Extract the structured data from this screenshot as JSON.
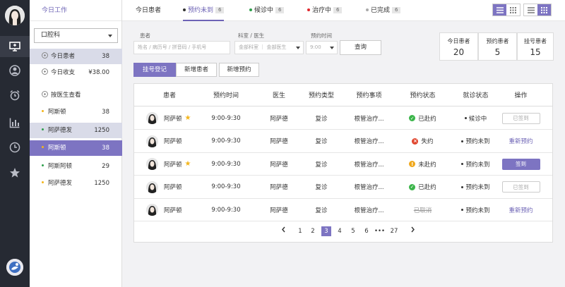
{
  "sidebar": {
    "header": "今日工作",
    "department": "口腔科",
    "rows": [
      {
        "label": "今日患者",
        "value": "38"
      },
      {
        "label": "今日收支",
        "value": "¥38.00"
      },
      {
        "label": "按医生查看",
        "value": ""
      },
      {
        "label": "阿斯顿",
        "value": "38",
        "dot": "#f3b51b"
      },
      {
        "label": "阿萨德发",
        "value": "1250",
        "dot": "#2e9f4b"
      },
      {
        "label": "阿斯顿",
        "value": "38",
        "dot": "#f3b51b"
      },
      {
        "label": "阿斯阿顿",
        "value": "29",
        "dot": "#2e9f4b"
      },
      {
        "label": "阿萨德发",
        "value": "1250",
        "dot": "#f3b51b"
      }
    ]
  },
  "tabs": [
    {
      "label": "今日患者",
      "count": ""
    },
    {
      "label": "预约未到",
      "count": "6",
      "dot": "#333333"
    },
    {
      "label": "候诊中",
      "count": "6",
      "dot": "#2e9f4b"
    },
    {
      "label": "治疗中",
      "count": "6",
      "dot": "#e0282e"
    },
    {
      "label": "已完成",
      "count": "6",
      "dot": "#aaaaaa"
    }
  ],
  "filters": {
    "patient_label": "患者",
    "patient_placeholder": "姓名 / 病历号 / 拼音码 / 手机号",
    "dept_label": "科室 / 医生",
    "dept_value": "金部科室 ｜ 金部医生",
    "time_label": "预约时间",
    "time_value": "9:00",
    "query": "查询"
  },
  "stats": [
    {
      "label": "今日患者",
      "value": "20"
    },
    {
      "label": "预约患者",
      "value": "5"
    },
    {
      "label": "挂号患者",
      "value": "15"
    }
  ],
  "actions": [
    "挂号登记",
    "新增患者",
    "新增预约"
  ],
  "table": {
    "headers": [
      "患者",
      "预约时间",
      "医生",
      "预约类型",
      "预约事项",
      "预约状态",
      "就诊状态",
      "操作"
    ],
    "rows": [
      {
        "name": "阿萨顿",
        "star": true,
        "time": "9:00-9:30",
        "doctor": "阿萨德",
        "type": "复诊",
        "item": "根管治疗...",
        "status": "已赴约",
        "status_color": "#3bb54a",
        "status_glyph": "✓",
        "visit": "候诊中",
        "op": "已签到",
        "op_style": "disabled"
      },
      {
        "name": "阿萨顿",
        "star": false,
        "time": "9:00-9:30",
        "doctor": "阿萨德",
        "type": "复诊",
        "item": "根管治疗...",
        "status": "失约",
        "status_color": "#e0462e",
        "status_glyph": "×",
        "visit": "预约未到",
        "op": "重新预约",
        "op_style": "link"
      },
      {
        "name": "阿萨顿",
        "star": true,
        "time": "9:00-9:30",
        "doctor": "阿萨德",
        "type": "复诊",
        "item": "根管治疗...",
        "status": "未赴约",
        "status_color": "#f0a81c",
        "status_glyph": "!",
        "visit": "预约未到",
        "op": "签到",
        "op_style": "primary"
      },
      {
        "name": "阿萨顿",
        "star": false,
        "time": "9:00-9:30",
        "doctor": "阿萨德",
        "type": "复诊",
        "item": "根管治疗...",
        "status": "已赴约",
        "status_color": "#3bb54a",
        "status_glyph": "✓",
        "visit": "预约未到",
        "op": "已签到",
        "op_style": "disabled"
      },
      {
        "name": "阿萨顿",
        "star": false,
        "time": "9:00-9:30",
        "doctor": "阿萨德",
        "type": "复诊",
        "item": "根管治疗...",
        "status": "已取消",
        "status_color": "",
        "status_glyph": "",
        "visit": "预约未到",
        "op": "重新预约",
        "op_style": "link"
      }
    ]
  },
  "pager": {
    "pages": [
      "1",
      "2",
      "3",
      "4",
      "5",
      "6",
      "•••",
      "27"
    ],
    "current": "3"
  },
  "colors": {
    "accent": "#7d74c2",
    "rail": "#262a33"
  }
}
